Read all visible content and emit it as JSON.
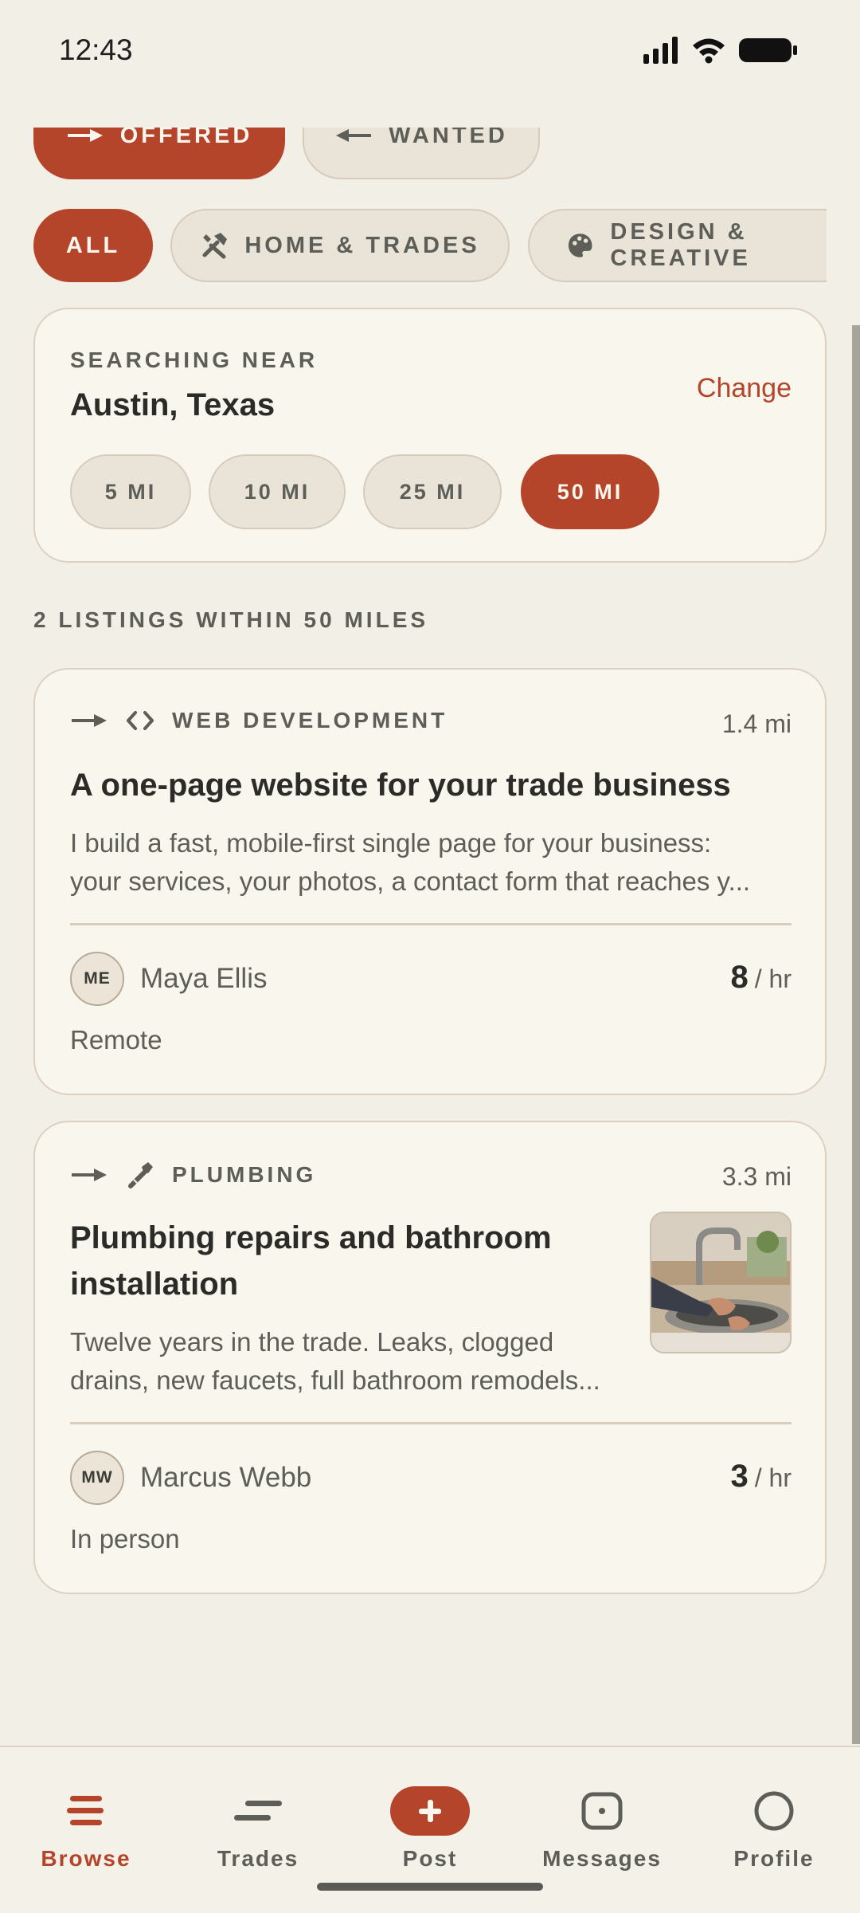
{
  "status_bar": {
    "time": "12:43"
  },
  "direction_filters": [
    {
      "label": "OFFERED",
      "icon": "arrow-right-icon",
      "active": true
    },
    {
      "label": "WANTED",
      "icon": "arrow-left-icon",
      "active": false
    }
  ],
  "category_filters": [
    {
      "label": "ALL",
      "active": true
    },
    {
      "label": "HOME & TRADES",
      "icon": "tools-icon",
      "active": false
    },
    {
      "label": "DESIGN & CREATIVE",
      "icon": "palette-icon",
      "active": false
    }
  ],
  "search": {
    "label": "SEARCHING NEAR",
    "city": "Austin, Texas",
    "change_label": "Change",
    "radius_options": [
      "5 MI",
      "10 MI",
      "25 MI",
      "50 MI"
    ],
    "selected_radius": "50 MI"
  },
  "listings_count": "2 LISTINGS WITHIN 50 MILES",
  "listings": [
    {
      "type_icon": "arrow-right-icon",
      "category_icon": "code-icon",
      "category": "WEB DEVELOPMENT",
      "distance": "1.4 mi",
      "title": "A one-page website for your trade business",
      "description_line1": "I build a fast, mobile-first single page for your business:",
      "description_line2": "your services, your photos, a contact form that reaches y...",
      "owner_initials": "ME",
      "owner_name": "Maya Ellis",
      "rate": "8",
      "rate_unit": "/ hr",
      "mode": "Remote"
    },
    {
      "type_icon": "arrow-right-icon",
      "category_icon": "wrench-icon",
      "category": "PLUMBING",
      "distance": "3.3 mi",
      "title_line1": "Plumbing repairs and bathroom",
      "title_line2": "installation",
      "description_line1": "Twelve years in the trade. Leaks, clogged",
      "description_line2": "drains, new faucets, full bathroom remodels...",
      "owner_initials": "MW",
      "owner_name": "Marcus Webb",
      "rate": "3",
      "rate_unit": "/ hr",
      "mode": "In person"
    }
  ],
  "bottom_nav": [
    {
      "label": "Browse",
      "icon": "browse-icon",
      "active": true
    },
    {
      "label": "Trades",
      "icon": "trades-icon",
      "active": false
    },
    {
      "label": "Post",
      "icon": "plus-icon",
      "active": false
    },
    {
      "label": "Messages",
      "icon": "messages-icon",
      "active": false
    },
    {
      "label": "Profile",
      "icon": "profile-icon",
      "active": false
    }
  ],
  "colors": {
    "accent": "#b4452b",
    "background": "#f2efe7",
    "card": "#f9f6ee",
    "muted_text": "#5d5e57"
  }
}
